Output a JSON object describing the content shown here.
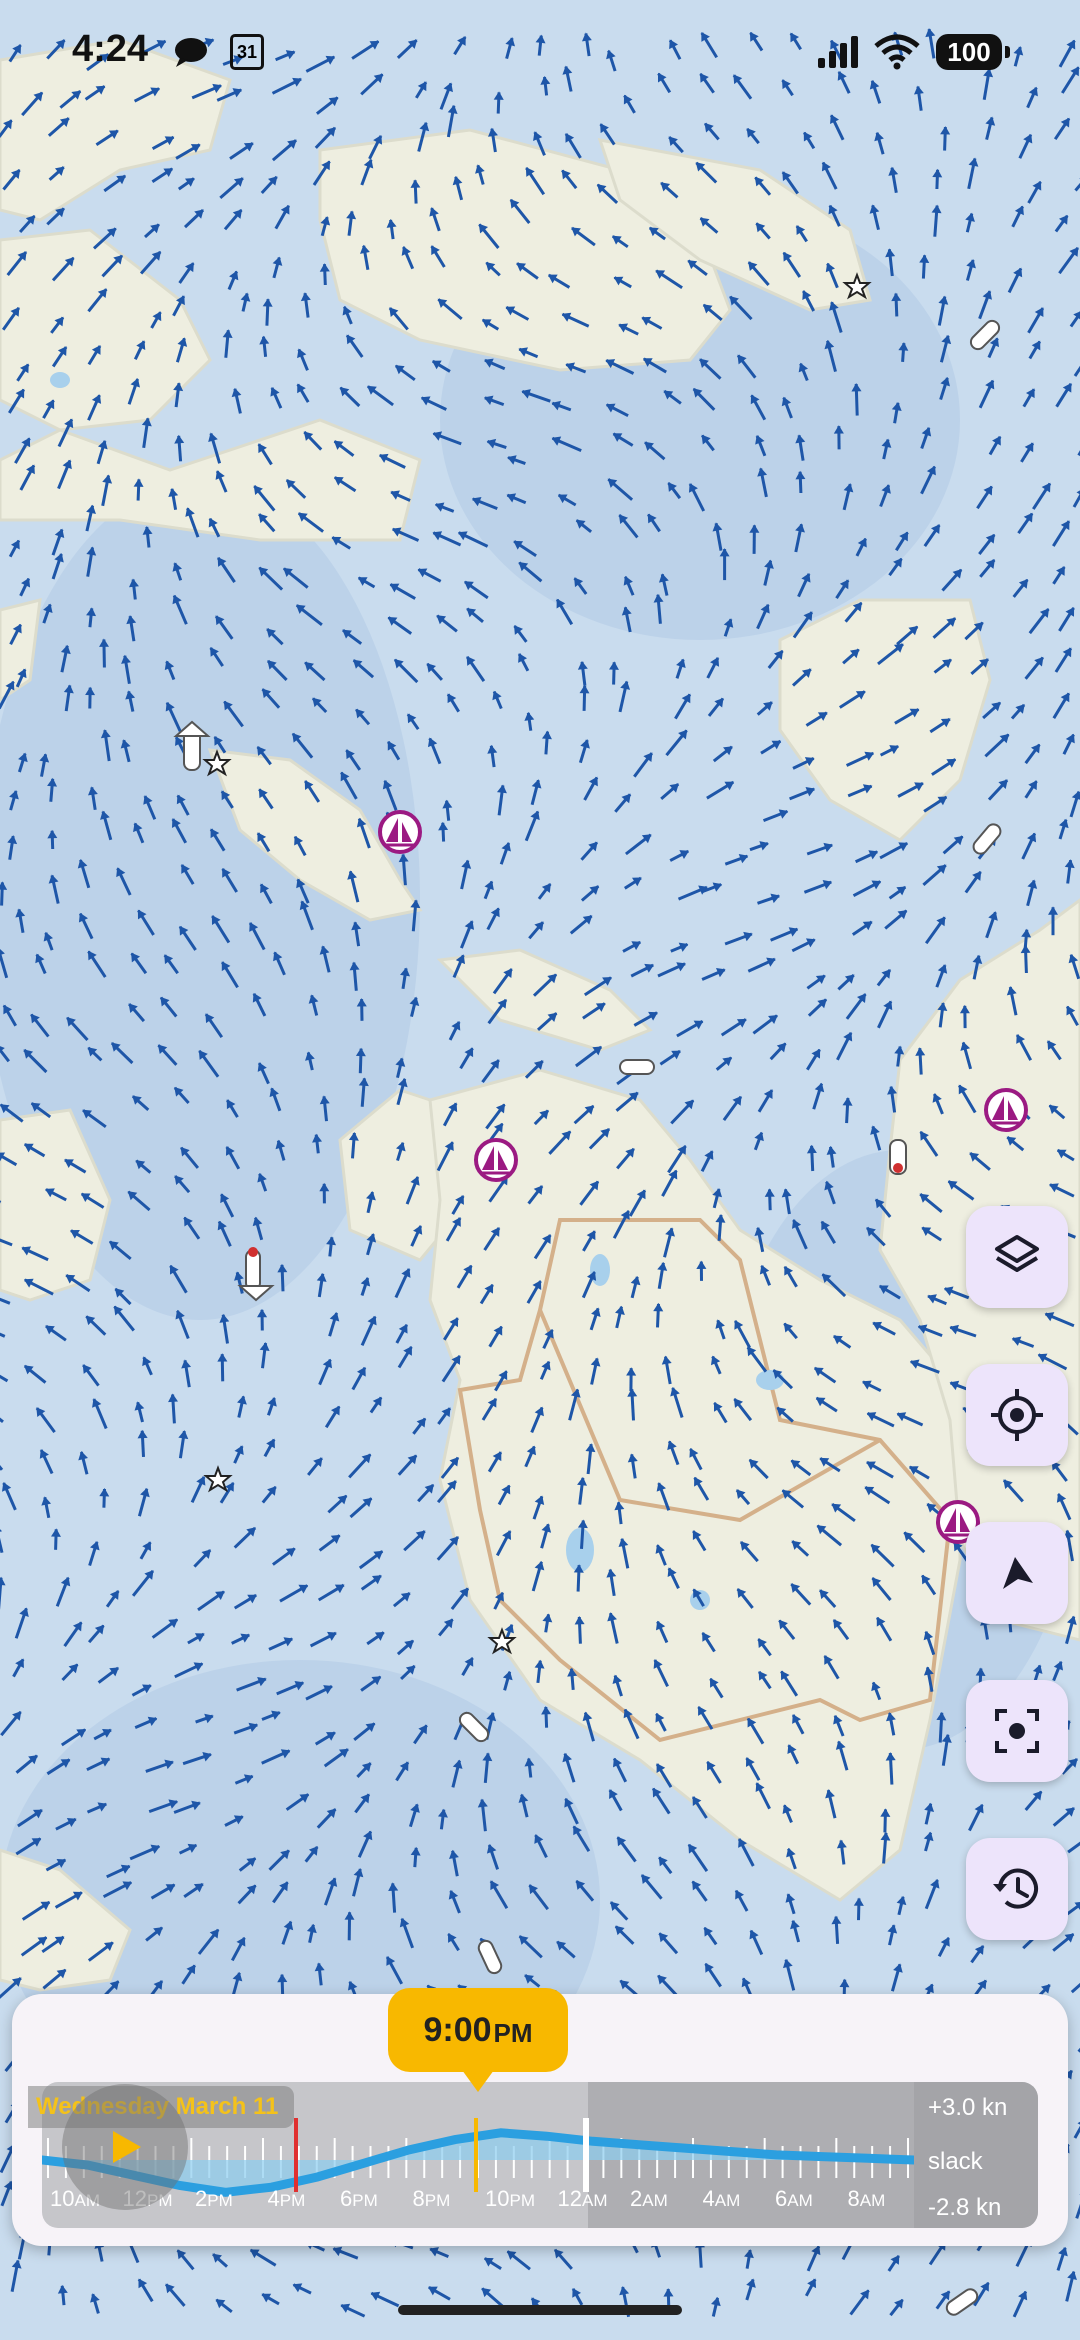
{
  "status_bar": {
    "time": "4:24",
    "icons": [
      "messages-icon",
      "calendar-icon",
      "signal-icon",
      "wifi-icon"
    ],
    "battery": "100",
    "calendar_day": "31"
  },
  "map": {
    "colors": {
      "water": "#c9dcee",
      "land": "#eeeee0",
      "arrow": "#1e56a8",
      "boundary": "#d4b08a",
      "marina": "#9b1a82"
    },
    "markers": [
      "marina-icon",
      "marina-icon",
      "marina-icon",
      "marina-icon",
      "star-icon",
      "star-icon",
      "star-icon",
      "star-icon"
    ]
  },
  "side_buttons": [
    {
      "name": "layers-button",
      "icon": "layers-icon"
    },
    {
      "name": "locate-button",
      "icon": "gps-target-icon"
    },
    {
      "name": "navigate-button",
      "icon": "navigation-arrow-icon"
    },
    {
      "name": "fit-view-button",
      "icon": "focus-frame-icon"
    },
    {
      "name": "history-button",
      "icon": "history-icon"
    }
  ],
  "tide": {
    "selected_time": "9:00",
    "selected_ampm": "PM",
    "date": "Wednesday March 11",
    "scale_max": "+3.0 kn",
    "scale_mid": "slack",
    "scale_min": "-2.8 kn",
    "hour_labels": [
      {
        "num": "10",
        "ampm": "AM"
      },
      {
        "num": "12",
        "ampm": "PM"
      },
      {
        "num": "2",
        "ampm": "PM"
      },
      {
        "num": "4",
        "ampm": "PM"
      },
      {
        "num": "6",
        "ampm": "PM"
      },
      {
        "num": "8",
        "ampm": "PM"
      },
      {
        "num": "10",
        "ampm": "PM"
      },
      {
        "num": "12",
        "ampm": "AM"
      },
      {
        "num": "2",
        "ampm": "AM"
      },
      {
        "num": "4",
        "ampm": "AM"
      },
      {
        "num": "6",
        "ampm": "AM"
      },
      {
        "num": "8",
        "ampm": "AM"
      }
    ],
    "current_curve_kn": [
      0.0,
      -0.3,
      -0.9,
      -1.5,
      -1.9,
      -1.6,
      -1.0,
      -0.2,
      0.6,
      1.2,
      1.6,
      1.4,
      1.1,
      0.9,
      0.7,
      0.5,
      0.3,
      0.2,
      0.1,
      0.0
    ],
    "colors": {
      "bubble": "#f8b800",
      "curve": "#2b9fe0",
      "now_marker": "#e03030"
    }
  }
}
